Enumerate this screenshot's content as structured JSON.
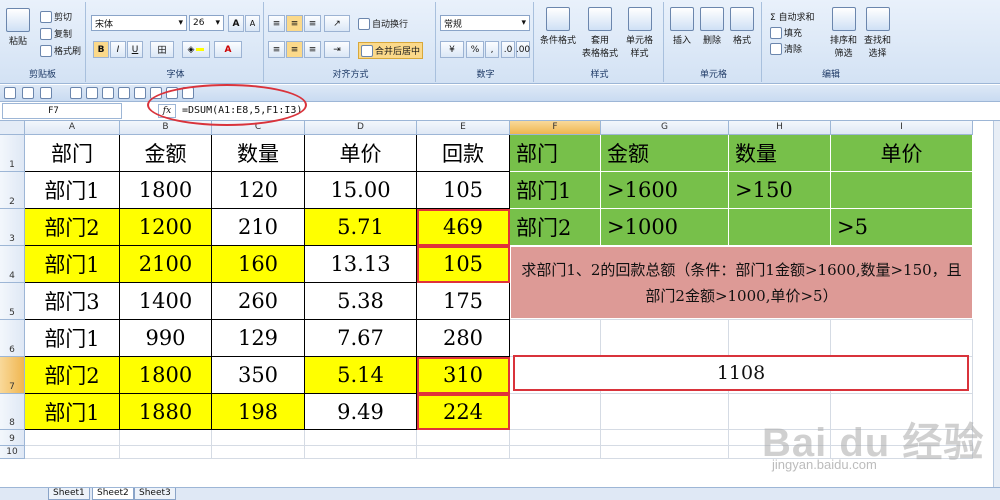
{
  "ribbon": {
    "clipboard": {
      "paste": "粘贴",
      "cut": "剪切",
      "copy": "复制",
      "format_painter": "格式刷",
      "label": "剪贴板"
    },
    "font": {
      "name": "宋体",
      "size": "26",
      "grow": "A",
      "shrink": "A",
      "bold": "B",
      "italic": "I",
      "underline": "U",
      "font_color": "A",
      "label": "字体"
    },
    "alignment": {
      "wrap": "自动换行",
      "merge": "合并后居中",
      "label": "对齐方式"
    },
    "number": {
      "format": "常规",
      "percent": "%",
      "comma": ",",
      "label": "数字"
    },
    "styles": {
      "conditional": "条件格式",
      "table_format": "套用\n表格格式",
      "cell_styles": "单元格\n样式",
      "label": "样式"
    },
    "cells": {
      "insert": "插入",
      "delete": "删除",
      "format": "格式",
      "label": "单元格"
    },
    "editing": {
      "autosum": "Σ 自动求和",
      "fill": "填充",
      "clear": "清除",
      "sort": "排序和\n筛选",
      "find": "查找和\n选择",
      "label": "编辑"
    }
  },
  "formula_bar": {
    "name_box": "F7",
    "fx": "fx",
    "formula": "=DSUM(A1:E8,5,F1:I3)"
  },
  "columns": [
    "A",
    "B",
    "C",
    "D",
    "E",
    "F",
    "G",
    "H",
    "I"
  ],
  "rows": [
    "1",
    "2",
    "3",
    "4",
    "5",
    "6",
    "7",
    "8",
    "9",
    "10"
  ],
  "table": {
    "headers": [
      "部门",
      "金额",
      "数量",
      "单价",
      "回款"
    ],
    "rows": [
      [
        "部门1",
        "1800",
        "120",
        "15.00",
        "105"
      ],
      [
        "部门2",
        "1200",
        "210",
        "5.71",
        "469"
      ],
      [
        "部门1",
        "2100",
        "160",
        "13.13",
        "105"
      ],
      [
        "部门3",
        "1400",
        "260",
        "5.38",
        "175"
      ],
      [
        "部门1",
        "990",
        "129",
        "7.67",
        "280"
      ],
      [
        "部门2",
        "1800",
        "350",
        "5.14",
        "310"
      ],
      [
        "部门1",
        "1880",
        "198",
        "9.49",
        "224"
      ]
    ]
  },
  "criteria": {
    "headers": [
      "部门",
      "金额",
      "数量",
      "单价"
    ],
    "rows": [
      [
        "部门1",
        ">1600",
        ">150",
        ""
      ],
      [
        "部门2",
        ">1000",
        "",
        ">5"
      ]
    ]
  },
  "note": "求部门1、2的回款总额（条件：部门1金额>1600,数量>150，且部门2金额>1000,单价>5）",
  "result": "1108",
  "sheets": [
    "Sheet1",
    "Sheet2",
    "Sheet3"
  ],
  "watermark": {
    "brand": "Bai du 经验",
    "url": "jingyan.baidu.com"
  },
  "colors": {
    "green": "#77c04a",
    "yellow": "#ffff00",
    "pink": "#dd9a96",
    "red_outline": "#e0333a"
  }
}
